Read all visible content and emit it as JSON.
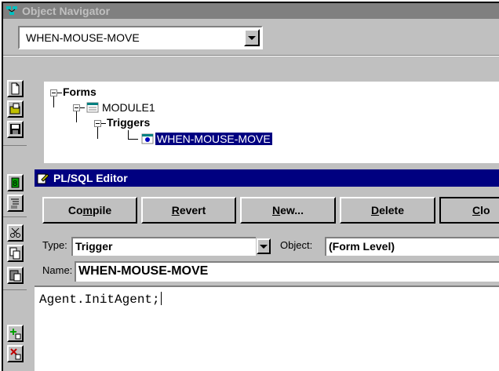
{
  "navigator": {
    "title": "Object Navigator",
    "selector_value": "WHEN-MOUSE-MOVE",
    "tree": [
      {
        "label": "Forms",
        "bold": true
      },
      {
        "label": "MODULE1",
        "bold": false
      },
      {
        "label": "Triggers",
        "bold": true
      },
      {
        "label": "WHEN-MOUSE-MOVE",
        "bold": false,
        "selected": true
      }
    ],
    "toolbar_icons": [
      "new-icon",
      "open-icon",
      "save-icon",
      "run-icon",
      "debug-icon",
      "cut-icon",
      "copy-icon",
      "paste-icon",
      "create-icon",
      "delete-icon"
    ]
  },
  "editor": {
    "title": "PL/SQL Editor",
    "buttons": [
      {
        "label": "Compile",
        "key": "m"
      },
      {
        "label": "Revert",
        "key": "R"
      },
      {
        "label": "New...",
        "key": "N"
      },
      {
        "label": "Delete",
        "key": "D"
      },
      {
        "label": "Clo",
        "key": "C"
      }
    ],
    "type_label": "Type:",
    "type_value": "Trigger",
    "object_label": "Object:",
    "object_value": "(Form Level)",
    "name_label": "Name:",
    "name_value": "WHEN-MOUSE-MOVE",
    "code": "Agent.InitAgent;"
  },
  "colors": {
    "active_title": "#000080",
    "inactive_title": "#808080",
    "face": "#c0c0c0",
    "selection": "#000080"
  }
}
